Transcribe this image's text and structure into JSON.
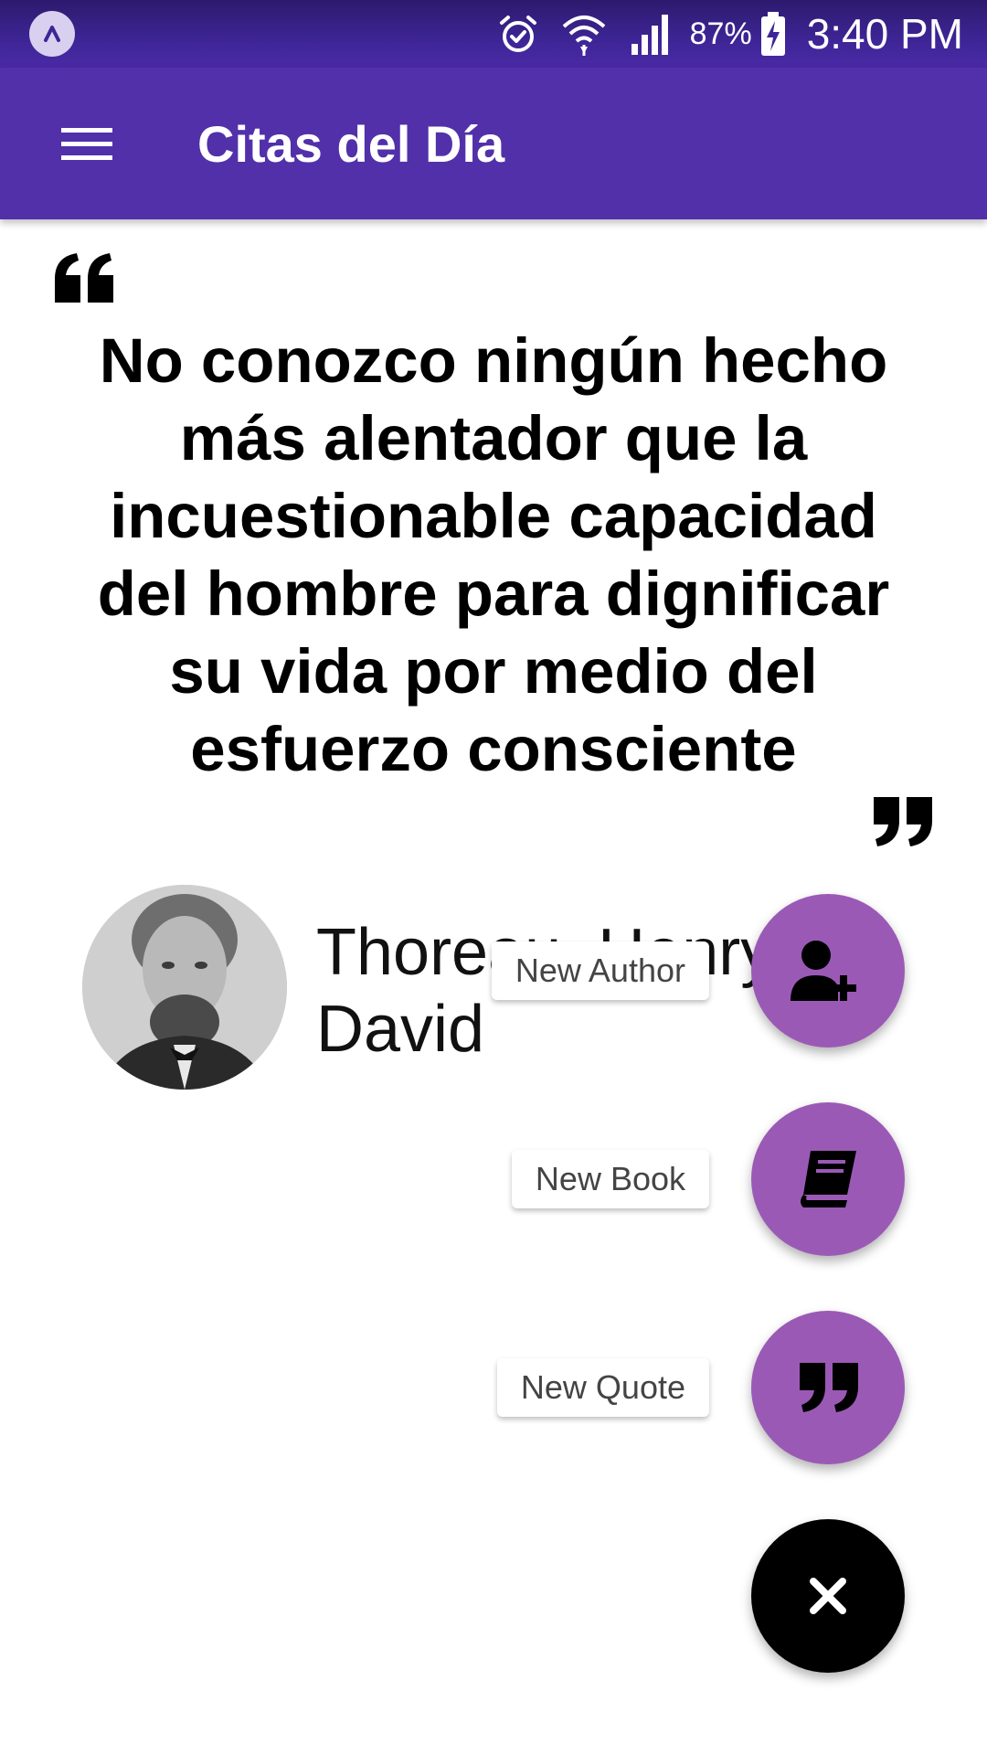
{
  "status_bar": {
    "battery_percent": "87%",
    "time": "3:40 PM",
    "icons": [
      "app-notification-icon",
      "alarm-icon",
      "wifi-icon",
      "signal-icon",
      "battery-charging-icon"
    ]
  },
  "app_bar": {
    "title": "Citas del Día",
    "menu_icon": "hamburger-menu-icon"
  },
  "quote": {
    "text": "No conozco ningún hecho más alentador que la incuestionable capacidad del hombre para dignificar su vida por medio del esfuerzo consciente",
    "open_icon": "quote-left-icon",
    "close_icon": "quote-right-icon"
  },
  "author": {
    "name": "Thoreau, Henry David"
  },
  "fab_menu": {
    "actions": [
      {
        "label": "New Author",
        "icon": "user-plus-icon"
      },
      {
        "label": "New Book",
        "icon": "book-icon"
      },
      {
        "label": "New Quote",
        "icon": "quote-right-icon"
      }
    ],
    "close_icon": "close-icon"
  },
  "colors": {
    "status_bar": "#3e2596",
    "app_bar": "#5230aa",
    "fab": "#9b59b6",
    "fab_close": "#000000"
  }
}
